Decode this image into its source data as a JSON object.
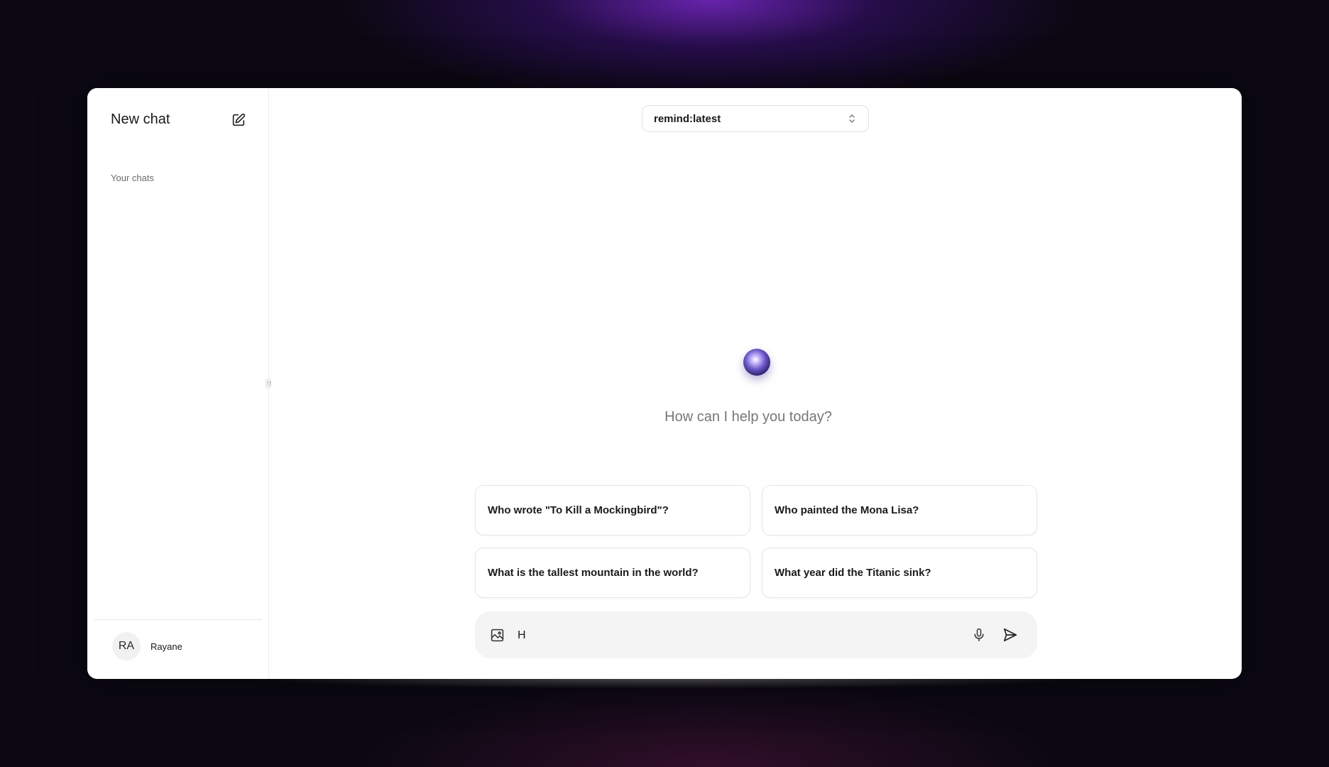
{
  "sidebar": {
    "title": "New chat",
    "new_chat_icon": "pencil-square-icon",
    "section_label": "Your chats",
    "user": {
      "initials": "RA",
      "name": "Rayane"
    }
  },
  "header": {
    "model_selector": {
      "value": "remind:latest",
      "icon": "chevron-up-down-icon"
    }
  },
  "main": {
    "greeting": "How can I help you today?",
    "suggestions": [
      "Who wrote \"To Kill a Mockingbird\"?",
      "Who painted the Mona Lisa?",
      "What is the tallest mountain in the world?",
      "What year did the Titanic sink?"
    ]
  },
  "composer": {
    "value": "H",
    "image_icon": "image-upload-icon",
    "mic_icon": "microphone-icon",
    "send_icon": "send-icon"
  },
  "colors": {
    "background": "#0b0812",
    "glow": "#7828c8",
    "window": "#ffffff",
    "composer": "#f4f4f4"
  }
}
